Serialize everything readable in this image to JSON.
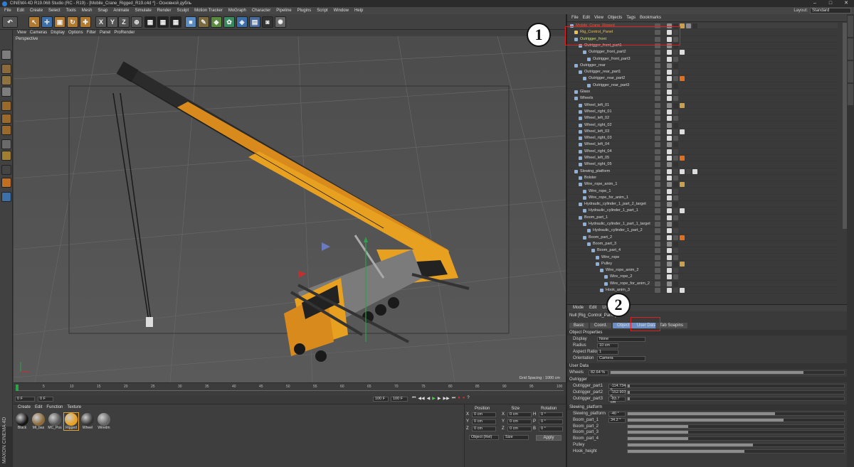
{
  "window": {
    "title": "CINEMA 4D R19.068 Studio (RC - R19) - [Mobile_Crane_Rigged_R19.c4d *] - Основной дубль"
  },
  "menu": [
    "File",
    "Edit",
    "Create",
    "Select",
    "Tools",
    "Mesh",
    "Snap",
    "Animate",
    "Simulate",
    "Render",
    "Sculpt",
    "Motion Tracker",
    "MoGraph",
    "Character",
    "Pipeline",
    "Plugins",
    "Script",
    "Window",
    "Help"
  ],
  "layout": {
    "label": "Layout:",
    "value": "Standard"
  },
  "viewport": {
    "menu": [
      "View",
      "Cameras",
      "Display",
      "Options",
      "Filter",
      "Panel",
      "ProRender"
    ],
    "label": "Perspective",
    "grid_spacing": "Grid Spacing : 1000 cm"
  },
  "toolbar": {
    "axes": [
      "X",
      "Y",
      "Z"
    ]
  },
  "timeline": {
    "ticks": [
      "0",
      "5",
      "10",
      "15",
      "20",
      "25",
      "30",
      "35",
      "40",
      "45",
      "50",
      "55",
      "60",
      "65",
      "70",
      "75",
      "80",
      "85",
      "90",
      "95",
      "100"
    ],
    "frame_end": "0 F",
    "current": "0 F",
    "start": "0 F",
    "max": "100 F",
    "max2": "100 F"
  },
  "materials": {
    "menu": [
      "Create",
      "Edit",
      "Function",
      "Texture"
    ],
    "items": [
      "Black",
      "Mt_bas",
      "MC_Pos",
      "Rigged",
      "Wheel",
      "Wiredm"
    ]
  },
  "maxon": "MAXON CINEMA 4D",
  "coords": {
    "headers": [
      "Position",
      "Size",
      "Rotation"
    ],
    "rows": [
      {
        "axis": "X",
        "pos": "0 cm",
        "size_axis": "X",
        "size": "0 cm",
        "rot_axis": "H",
        "rot": "0 °"
      },
      {
        "axis": "Y",
        "pos": "0 cm",
        "size_axis": "Y",
        "size": "0 cm",
        "rot_axis": "P",
        "rot": "0 °"
      },
      {
        "axis": "Z",
        "pos": "0 cm",
        "size_axis": "Z",
        "size": "0 cm",
        "rot_axis": "B",
        "rot": "0 °"
      }
    ],
    "mode": "Object (Rel)",
    "size_mode": "Size",
    "apply": "Apply"
  },
  "objects": {
    "menu": [
      "File",
      "Edit",
      "View",
      "Objects",
      "Tags",
      "Bookmarks"
    ],
    "rows": [
      {
        "name": "Mobile_Crane_Rigged",
        "depth": 0,
        "color": "#e05a3a"
      },
      {
        "name": "Rig_Control_Panel",
        "depth": 1,
        "color": "#e8c05a"
      },
      {
        "name": "Outrigger_front",
        "depth": 1,
        "color": "#c8e070"
      },
      {
        "name": "Outrigger_front_part1",
        "depth": 2,
        "color": "#d8d8d8"
      },
      {
        "name": "Outrigger_front_part2",
        "depth": 3,
        "color": "#d8d8d8"
      },
      {
        "name": "Outrigger_front_part3",
        "depth": 4,
        "color": "#d8d8d8"
      },
      {
        "name": "Outrigger_rear",
        "depth": 1,
        "color": "#d8d8d8"
      },
      {
        "name": "Outrigger_rear_part1",
        "depth": 2,
        "color": "#d8d8d8"
      },
      {
        "name": "Outrigger_rear_part2",
        "depth": 3,
        "color": "#d8d8d8"
      },
      {
        "name": "Outrigger_rear_part3",
        "depth": 4,
        "color": "#d8d8d8"
      },
      {
        "name": "Glass",
        "depth": 1,
        "color": "#d8d8d8"
      },
      {
        "name": "Wheels",
        "depth": 1,
        "color": "#d8d8d8"
      },
      {
        "name": "Wheel_left_01",
        "depth": 2,
        "color": "#d8d8d8"
      },
      {
        "name": "Wheel_right_01",
        "depth": 2,
        "color": "#d8d8d8"
      },
      {
        "name": "Wheel_left_02",
        "depth": 2,
        "color": "#d8d8d8"
      },
      {
        "name": "Wheel_right_02",
        "depth": 2,
        "color": "#d8d8d8"
      },
      {
        "name": "Wheel_left_03",
        "depth": 2,
        "color": "#d8d8d8"
      },
      {
        "name": "Wheel_right_03",
        "depth": 2,
        "color": "#d8d8d8"
      },
      {
        "name": "Wheel_left_04",
        "depth": 2,
        "color": "#d8d8d8"
      },
      {
        "name": "Wheel_right_04",
        "depth": 2,
        "color": "#d8d8d8"
      },
      {
        "name": "Wheel_left_05",
        "depth": 2,
        "color": "#d8d8d8"
      },
      {
        "name": "Wheel_right_05",
        "depth": 2,
        "color": "#d8d8d8"
      },
      {
        "name": "Slewing_platform",
        "depth": 1,
        "color": "#d8d8d8"
      },
      {
        "name": "Bolster",
        "depth": 2,
        "color": "#d8d8d8"
      },
      {
        "name": "Wire_rope_anim_1",
        "depth": 2,
        "color": "#d8d8d8"
      },
      {
        "name": "Wire_rope_1",
        "depth": 3,
        "color": "#d8d8d8"
      },
      {
        "name": "Wire_rope_for_anim_1",
        "depth": 3,
        "color": "#d8d8d8"
      },
      {
        "name": "Hydraulic_cylinder_1_part_2_target",
        "depth": 2,
        "color": "#d8d8d8"
      },
      {
        "name": "Hydraulic_cylinder_1_part_1",
        "depth": 3,
        "color": "#d8d8d8"
      },
      {
        "name": "Boom_part_1",
        "depth": 2,
        "color": "#d8d8d8"
      },
      {
        "name": "Hydraulic_cylinder_1_part_1_target",
        "depth": 3,
        "color": "#d8d8d8"
      },
      {
        "name": "Hydraulic_cylinder_1_part_2",
        "depth": 4,
        "color": "#d8d8d8"
      },
      {
        "name": "Boom_part_2",
        "depth": 3,
        "color": "#d8d8d8"
      },
      {
        "name": "Boom_part_3",
        "depth": 4,
        "color": "#d8d8d8"
      },
      {
        "name": "Boom_part_4",
        "depth": 5,
        "color": "#d8d8d8"
      },
      {
        "name": "Wire_rope",
        "depth": 6,
        "color": "#d8d8d8"
      },
      {
        "name": "Pulley",
        "depth": 6,
        "color": "#d8d8d8"
      },
      {
        "name": "Wire_rope_anim_2",
        "depth": 7,
        "color": "#d8d8d8"
      },
      {
        "name": "Wire_rope_2",
        "depth": 8,
        "color": "#d8d8d8"
      },
      {
        "name": "Wire_rope_for_anim_2",
        "depth": 8,
        "color": "#d8d8d8"
      },
      {
        "name": "Hook_anim_3",
        "depth": 7,
        "color": "#d8d8d8"
      }
    ]
  },
  "attributes": {
    "menu": [
      "Mode",
      "Edit",
      "User Data"
    ],
    "object_name": "Null [Rig_Control_Panel]",
    "tabs": [
      "Basic",
      "Coord.",
      "Object",
      "User Data",
      "Tab Soapins"
    ],
    "object_properties": "Object Properties",
    "props": [
      {
        "label": "Display",
        "value": "None"
      },
      {
        "label": "Radius",
        "value": "10 cm"
      },
      {
        "label": "Aspect Ratio",
        "value": "1"
      },
      {
        "label": "Orientation",
        "value": "Camera"
      }
    ],
    "user_data": "User Data",
    "wheels": {
      "label": "Wheels",
      "value": "82.64 %",
      "fraction": 0.8264
    },
    "outrigger_group": "Outrigger",
    "outrigger": [
      {
        "label": "Outrigger_part1",
        "value": "-114.734 c",
        "fraction": 0.01
      },
      {
        "label": "Outrigger_part2",
        "value": "-152.907 c",
        "fraction": 0.01
      },
      {
        "label": "Outrigger_part3",
        "value": "-83.7 cm",
        "fraction": 0.01
      }
    ],
    "slewing_group": "Slewing_platform",
    "slewing": [
      {
        "label": "Slewing_platform",
        "value": "-40 °",
        "fraction": 0.68
      },
      {
        "label": "Boom_part_1",
        "value": "34.2 °",
        "fraction": 0.72
      },
      {
        "label": "Boom_part_2",
        "value": "",
        "fraction": 0.28
      },
      {
        "label": "Boom_part_3",
        "value": "",
        "fraction": 0.28
      },
      {
        "label": "Boom_part_4",
        "value": "",
        "fraction": 0.28
      },
      {
        "label": "Pulley",
        "value": "",
        "fraction": 0.58
      },
      {
        "label": "Hook_height",
        "value": "",
        "fraction": 0.54
      }
    ]
  },
  "callouts": [
    "1",
    "2"
  ],
  "colors": {
    "accent": "#e02020",
    "selection": "#6d8ec2",
    "orange": "#e8a020"
  }
}
